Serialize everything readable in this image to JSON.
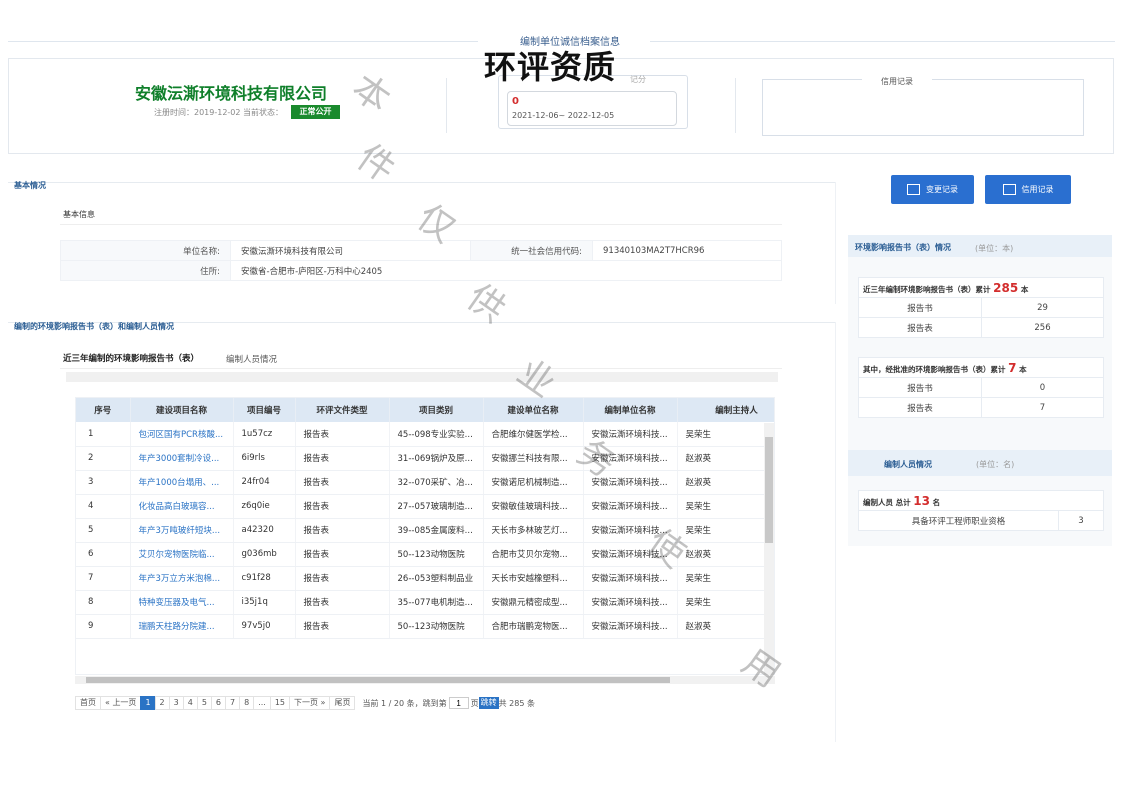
{
  "header": {
    "title": "编制单位诚信档案信息",
    "stamp": "环评资质"
  },
  "company": {
    "name": "安徽沄澌环境科技有限公司",
    "reg_text": "注册时间：2019-12-02   当前状态：",
    "status": "正常公开"
  },
  "score": {
    "label": "记分",
    "value": "0",
    "period": "2021-12-06~ 2022-12-05"
  },
  "credit_record": {
    "title": "信用记录"
  },
  "basic": {
    "section_title": "基本情况",
    "tab": "基本信息",
    "unit_label": "单位名称:",
    "unit_value": "安徽沄澌环境科技有限公司",
    "code_label": "统一社会信用代码:",
    "code_value": "91340103MA2T7HCR96",
    "addr_label": "住所:",
    "addr_value": "安徽省-合肥市-庐阳区-万科中心2405"
  },
  "reports": {
    "section_title": "编制的环境影响报告书（表）和编制人员情况",
    "tab_reports": "近三年编制的环境影响报告书（表）",
    "tab_staff": "编制人员情况",
    "columns": [
      "序号",
      "建设项目名称",
      "项目编号",
      "环评文件类型",
      "项目类别",
      "建设单位名称",
      "编制单位名称",
      "编制主持人"
    ],
    "rows": [
      [
        "1",
        "包河区国有PCR核酸...",
        "1u57cz",
        "报告表",
        "45--098专业实验...",
        "合肥维尔健医学检...",
        "安徽沄澌环境科技...",
        "吴荣生"
      ],
      [
        "2",
        "年产3000套制冷设...",
        "6i9rls",
        "报告表",
        "31--069锅炉及原...",
        "安徽挪兰科技有限...",
        "安徽沄澌环境科技...",
        "赵淑英"
      ],
      [
        "3",
        "年产1000台塌用、...",
        "24fr04",
        "报告表",
        "32--070采矿、冶...",
        "安徽诺尼机械制造...",
        "安徽沄澌环境科技...",
        "赵淑英"
      ],
      [
        "4",
        "化妆品高白玻璃容...",
        "z6q0ie",
        "报告表",
        "27--057玻璃制造...",
        "安徽敏佳玻璃科技...",
        "安徽沄澌环境科技...",
        "吴荣生"
      ],
      [
        "5",
        "年产3万吨玻纤短块...",
        "a42320",
        "报告表",
        "39--085金属废料...",
        "天长市多林玻艺灯...",
        "安徽沄澌环境科技...",
        "吴荣生"
      ],
      [
        "6",
        "艾贝尔宠物医院临...",
        "g036mb",
        "报告表",
        "50--123动物医院",
        "合肥市艾贝尔宠物...",
        "安徽沄澌环境科技...",
        "赵淑英"
      ],
      [
        "7",
        "年产3万立方米泡棉...",
        "c91f28",
        "报告表",
        "26--053塑料制品业",
        "天长市安越橡塑科...",
        "安徽沄澌环境科技...",
        "吴荣生"
      ],
      [
        "8",
        "特种变压器及电气...",
        "i35j1q",
        "报告表",
        "35--077电机制造...",
        "安徽鼎元精密成型...",
        "安徽沄澌环境科技...",
        "吴荣生"
      ],
      [
        "9",
        "瑞鹏天柱路分院建...",
        "97v5j0",
        "报告表",
        "50--123动物医院",
        "合肥市瑞鹏宠物医...",
        "安徽沄澌环境科技...",
        "赵淑英"
      ]
    ]
  },
  "pager": {
    "first": "首页",
    "prev": "« 上一页",
    "pages": [
      "1",
      "2",
      "3",
      "4",
      "5",
      "6",
      "7",
      "8",
      "...",
      "15"
    ],
    "next": "下一页 »",
    "last": "尾页",
    "current_text": "当前  1  /  20  条，跳到第",
    "jump_value": "1",
    "page_suffix": "页",
    "jump_label": "跳转",
    "total_text": "共 285 条"
  },
  "buttons": {
    "change": "变更记录",
    "credit": "信用记录"
  },
  "env": {
    "title": "环境影响报告书（表）情况",
    "unit": "(单位：本)",
    "three_year_prefix": "近三年编制环境影响报告书（表）累计",
    "three_year_total": "285",
    "three_year_suffix": "本",
    "book_label": "报告书",
    "book_count": "29",
    "form_label": "报告表",
    "form_count": "256",
    "approved_prefix": "其中，经批准的环境影响报告书（表）累计",
    "approved_total": "7",
    "approved_suffix": "本",
    "appr_book_label": "报告书",
    "appr_book_count": "0",
    "appr_form_label": "报告表",
    "appr_form_count": "7"
  },
  "staff": {
    "title": "编制人员情况",
    "unit": "(单位：名)",
    "total_prefix": "编制人员 总计",
    "total": "13",
    "total_suffix": "名",
    "qual_label": "具备环评工程师职业资格",
    "qual_count": "3"
  },
  "watermark": [
    "本",
    "件",
    "仅",
    "供",
    "业",
    "务",
    "使",
    "用"
  ]
}
